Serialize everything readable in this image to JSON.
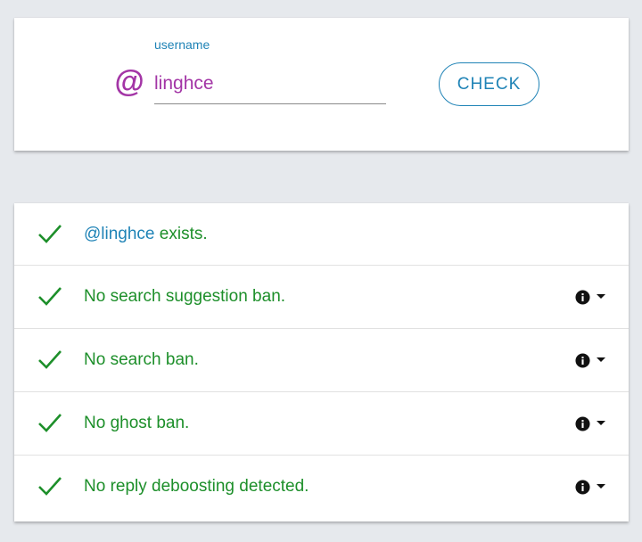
{
  "search": {
    "at_symbol": "@",
    "label": "username",
    "value": "linghce",
    "button_label": "CHECK"
  },
  "results": [
    {
      "handle": "@linghce",
      "text": " exists.",
      "status_icon": "check-icon",
      "has_details": false
    },
    {
      "text": "No search suggestion ban.",
      "status_icon": "check-icon",
      "has_details": true,
      "details_icons": [
        "info-icon",
        "caret-down-icon"
      ]
    },
    {
      "text": "No search ban.",
      "status_icon": "check-icon",
      "has_details": true,
      "details_icons": [
        "info-icon",
        "caret-down-icon"
      ]
    },
    {
      "text": "No ghost ban.",
      "status_icon": "check-icon",
      "has_details": true,
      "details_icons": [
        "info-icon",
        "caret-down-icon"
      ]
    },
    {
      "text": "No reply deboosting detected.",
      "status_icon": "check-icon",
      "has_details": true,
      "details_icons": [
        "info-icon",
        "caret-down-icon"
      ]
    }
  ],
  "colors": {
    "accent_blue": "#1f83b6",
    "accent_purple": "#a335a6",
    "success_green": "#1d8f2a",
    "background": "#e6e9ed"
  }
}
